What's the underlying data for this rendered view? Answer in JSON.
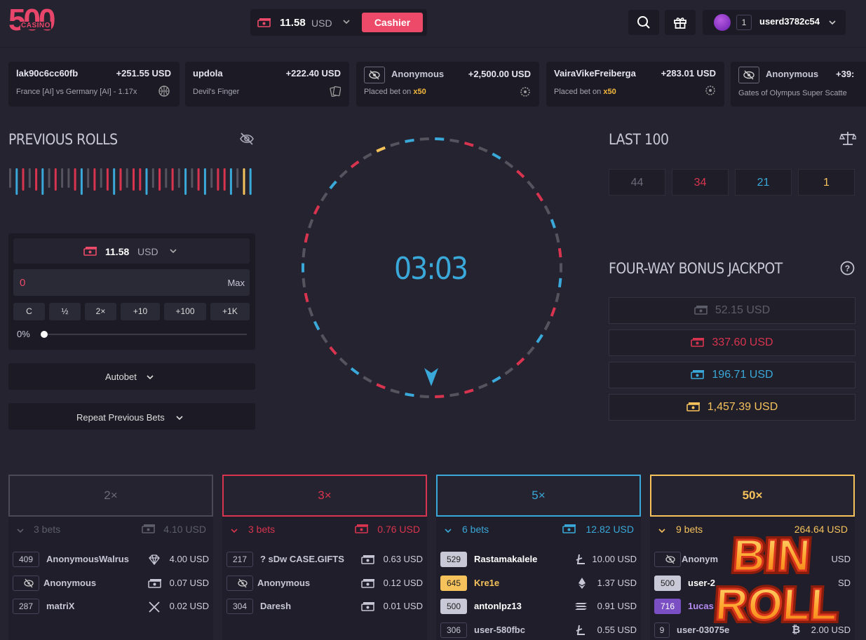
{
  "header": {
    "logo_main": "500",
    "logo_sub": "CASINO",
    "balance": "11.58",
    "currency": "USD",
    "cashier_label": "Cashier",
    "user_level": "1",
    "username": "userd3782c54"
  },
  "feed": [
    {
      "name": "lak90c6cc60fb",
      "amount": "+251.55 USD",
      "sub": "France [AI] vs Germany [AI] - 1.17x"
    },
    {
      "name": "updola",
      "amount": "+222.40 USD",
      "sub": "Devil's Finger"
    },
    {
      "name": "Anonymous",
      "amount": "+2,500.00 USD",
      "sub_prefix": "Placed bet on",
      "sub_mult": "x50"
    },
    {
      "name": "VairaVikeFreiberga",
      "amount": "+283.01 USD",
      "sub_prefix": "Placed bet on",
      "sub_mult": "x50"
    },
    {
      "name": "Anonymous",
      "amount": "+39:",
      "sub": "Gates of Olympus Super Scatte"
    }
  ],
  "previous_rolls": {
    "title": "PREVIOUS ROLLS",
    "colors": [
      "gray",
      "blue",
      "red",
      "gray",
      "red",
      "blue",
      "gray",
      "red",
      "gray",
      "gray",
      "red",
      "blue",
      "gray",
      "red",
      "gray",
      "red",
      "blue",
      "red",
      "gray",
      "red",
      "red",
      "blue",
      "gray",
      "red",
      "gray",
      "red",
      "gray",
      "blue",
      "gray",
      "red",
      "blue",
      "gray",
      "red",
      "red",
      "blue",
      "gray",
      "yellow",
      "blue"
    ]
  },
  "bet_panel": {
    "balance": "11.58",
    "currency": "USD",
    "amount_value": "0",
    "max_label": "Max",
    "quick_buttons": [
      "C",
      "½",
      "2×",
      "+10",
      "+100",
      "+1K"
    ],
    "slider_label": "0%",
    "slider_percent": 0,
    "autobet_label": "Autobet",
    "repeat_label": "Repeat Previous Bets"
  },
  "wheel": {
    "timer": "03:03"
  },
  "last100": {
    "title": "LAST 100",
    "values": [
      "44",
      "34",
      "21",
      "1"
    ]
  },
  "jackpot": {
    "title": "FOUR-WAY BONUS JACKPOT",
    "tiers": [
      "52.15 USD",
      "337.60 USD",
      "196.71 USD",
      "1,457.39 USD"
    ]
  },
  "colors": {
    "gray": "#55545e",
    "red": "#d9344f",
    "blue": "#3aa8d8",
    "yellow": "#f6c25c",
    "accent": "#ec4a68"
  },
  "columns": [
    {
      "label": "2×",
      "bets": "3 bets",
      "total": "4.10 USD",
      "rows": [
        {
          "badge": "409",
          "name": "AnonymousWalrus",
          "amount": "4.00 USD",
          "icon": "diamond-icon"
        },
        {
          "badge": "",
          "name": "Anonymous",
          "amount": "0.07 USD",
          "icon": "cash-icon"
        },
        {
          "badge": "287",
          "name": "matriX",
          "amount": "0.02 USD",
          "icon": "x-coin-icon"
        }
      ]
    },
    {
      "label": "3×",
      "bets": "3 bets",
      "total": "0.76 USD",
      "rows": [
        {
          "badge": "217",
          "name": "? sDw CASE.GIFTS",
          "amount": "0.63 USD",
          "icon": "cash-icon"
        },
        {
          "badge": "",
          "name": "Anonymous",
          "amount": "0.12 USD",
          "icon": "cash-icon"
        },
        {
          "badge": "304",
          "name": "Daresh",
          "amount": "0.01 USD",
          "icon": "cash-icon"
        }
      ]
    },
    {
      "label": "5×",
      "bets": "6 bets",
      "total": "12.82 USD",
      "rows": [
        {
          "badge": "529",
          "name": "Rastamakalele",
          "amount": "10.00 USD",
          "icon": "litecoin-icon"
        },
        {
          "badge": "645",
          "name": "Kre1e",
          "amount": "1.37 USD",
          "icon": "ethereum-icon"
        },
        {
          "badge": "500",
          "name": "antonlpz13",
          "amount": "0.91 USD",
          "icon": "solana-icon"
        },
        {
          "badge": "306",
          "name": "user-580fbc",
          "amount": "0.55 USD",
          "icon": "litecoin-icon"
        }
      ]
    },
    {
      "label": "50×",
      "bets": "9 bets",
      "total": "264.64 USD",
      "rows": [
        {
          "badge": "",
          "name": "Anonym",
          "amount": "USD",
          "icon": "cash-icon"
        },
        {
          "badge": "500",
          "name": "user-2",
          "amount": "SD",
          "icon": "cash-icon"
        },
        {
          "badge": "716",
          "name": "1ucas",
          "amount": "",
          "icon": "cash-icon"
        },
        {
          "badge": "9",
          "name": "user-03075e",
          "amount": "2.00 USD",
          "icon": "bitcoin-icon"
        }
      ]
    }
  ],
  "promo": {
    "line1": "BIN",
    "line2": "ROLL"
  }
}
